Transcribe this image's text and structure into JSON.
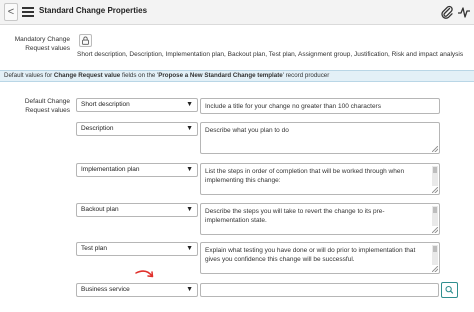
{
  "header": {
    "back_glyph": "<",
    "title": "Standard Change Properties",
    "icons": [
      "hamburger-menu-icon",
      "paperclip-icon",
      "activity-icon"
    ]
  },
  "mandatory": {
    "label": "Mandatory Change Request values",
    "values_text": "Short description, Description, Implementation plan, Backout plan, Test plan, Assignment group, Justification, Risk and impact analysis",
    "lock_icon": "lock-icon"
  },
  "info_bar": {
    "prefix": "Default values for ",
    "field_name": "Change Request value",
    "middle": " fields on the '",
    "producer_name": "Propose a New Standard Change template",
    "suffix": "' record producer"
  },
  "defaults": {
    "label": "Default Change Request values",
    "rows": [
      {
        "field": "Short description",
        "value": "Include a title for your change no greater than 100 characters"
      },
      {
        "field": "Description",
        "value": "Describe what you plan to do"
      },
      {
        "field": "Implementation plan",
        "value": "List the steps in order of completion that will be worked through when implementing this change:"
      },
      {
        "field": "Backout plan",
        "value": "Describe the steps you will take to revert the change to its pre-implementation state."
      },
      {
        "field": "Test plan",
        "value": "Explain what testing you have done or will do prior to implementation that gives you confidence this change will be successful."
      },
      {
        "field": "Business service",
        "value": ""
      }
    ],
    "caret_glyph": "▼",
    "lookup_icon": "search-icon"
  },
  "colors": {
    "accent": "#2f8f8f",
    "annotation_arrow": "#e0302b",
    "info_bar_bg": "#e3f0f7"
  }
}
